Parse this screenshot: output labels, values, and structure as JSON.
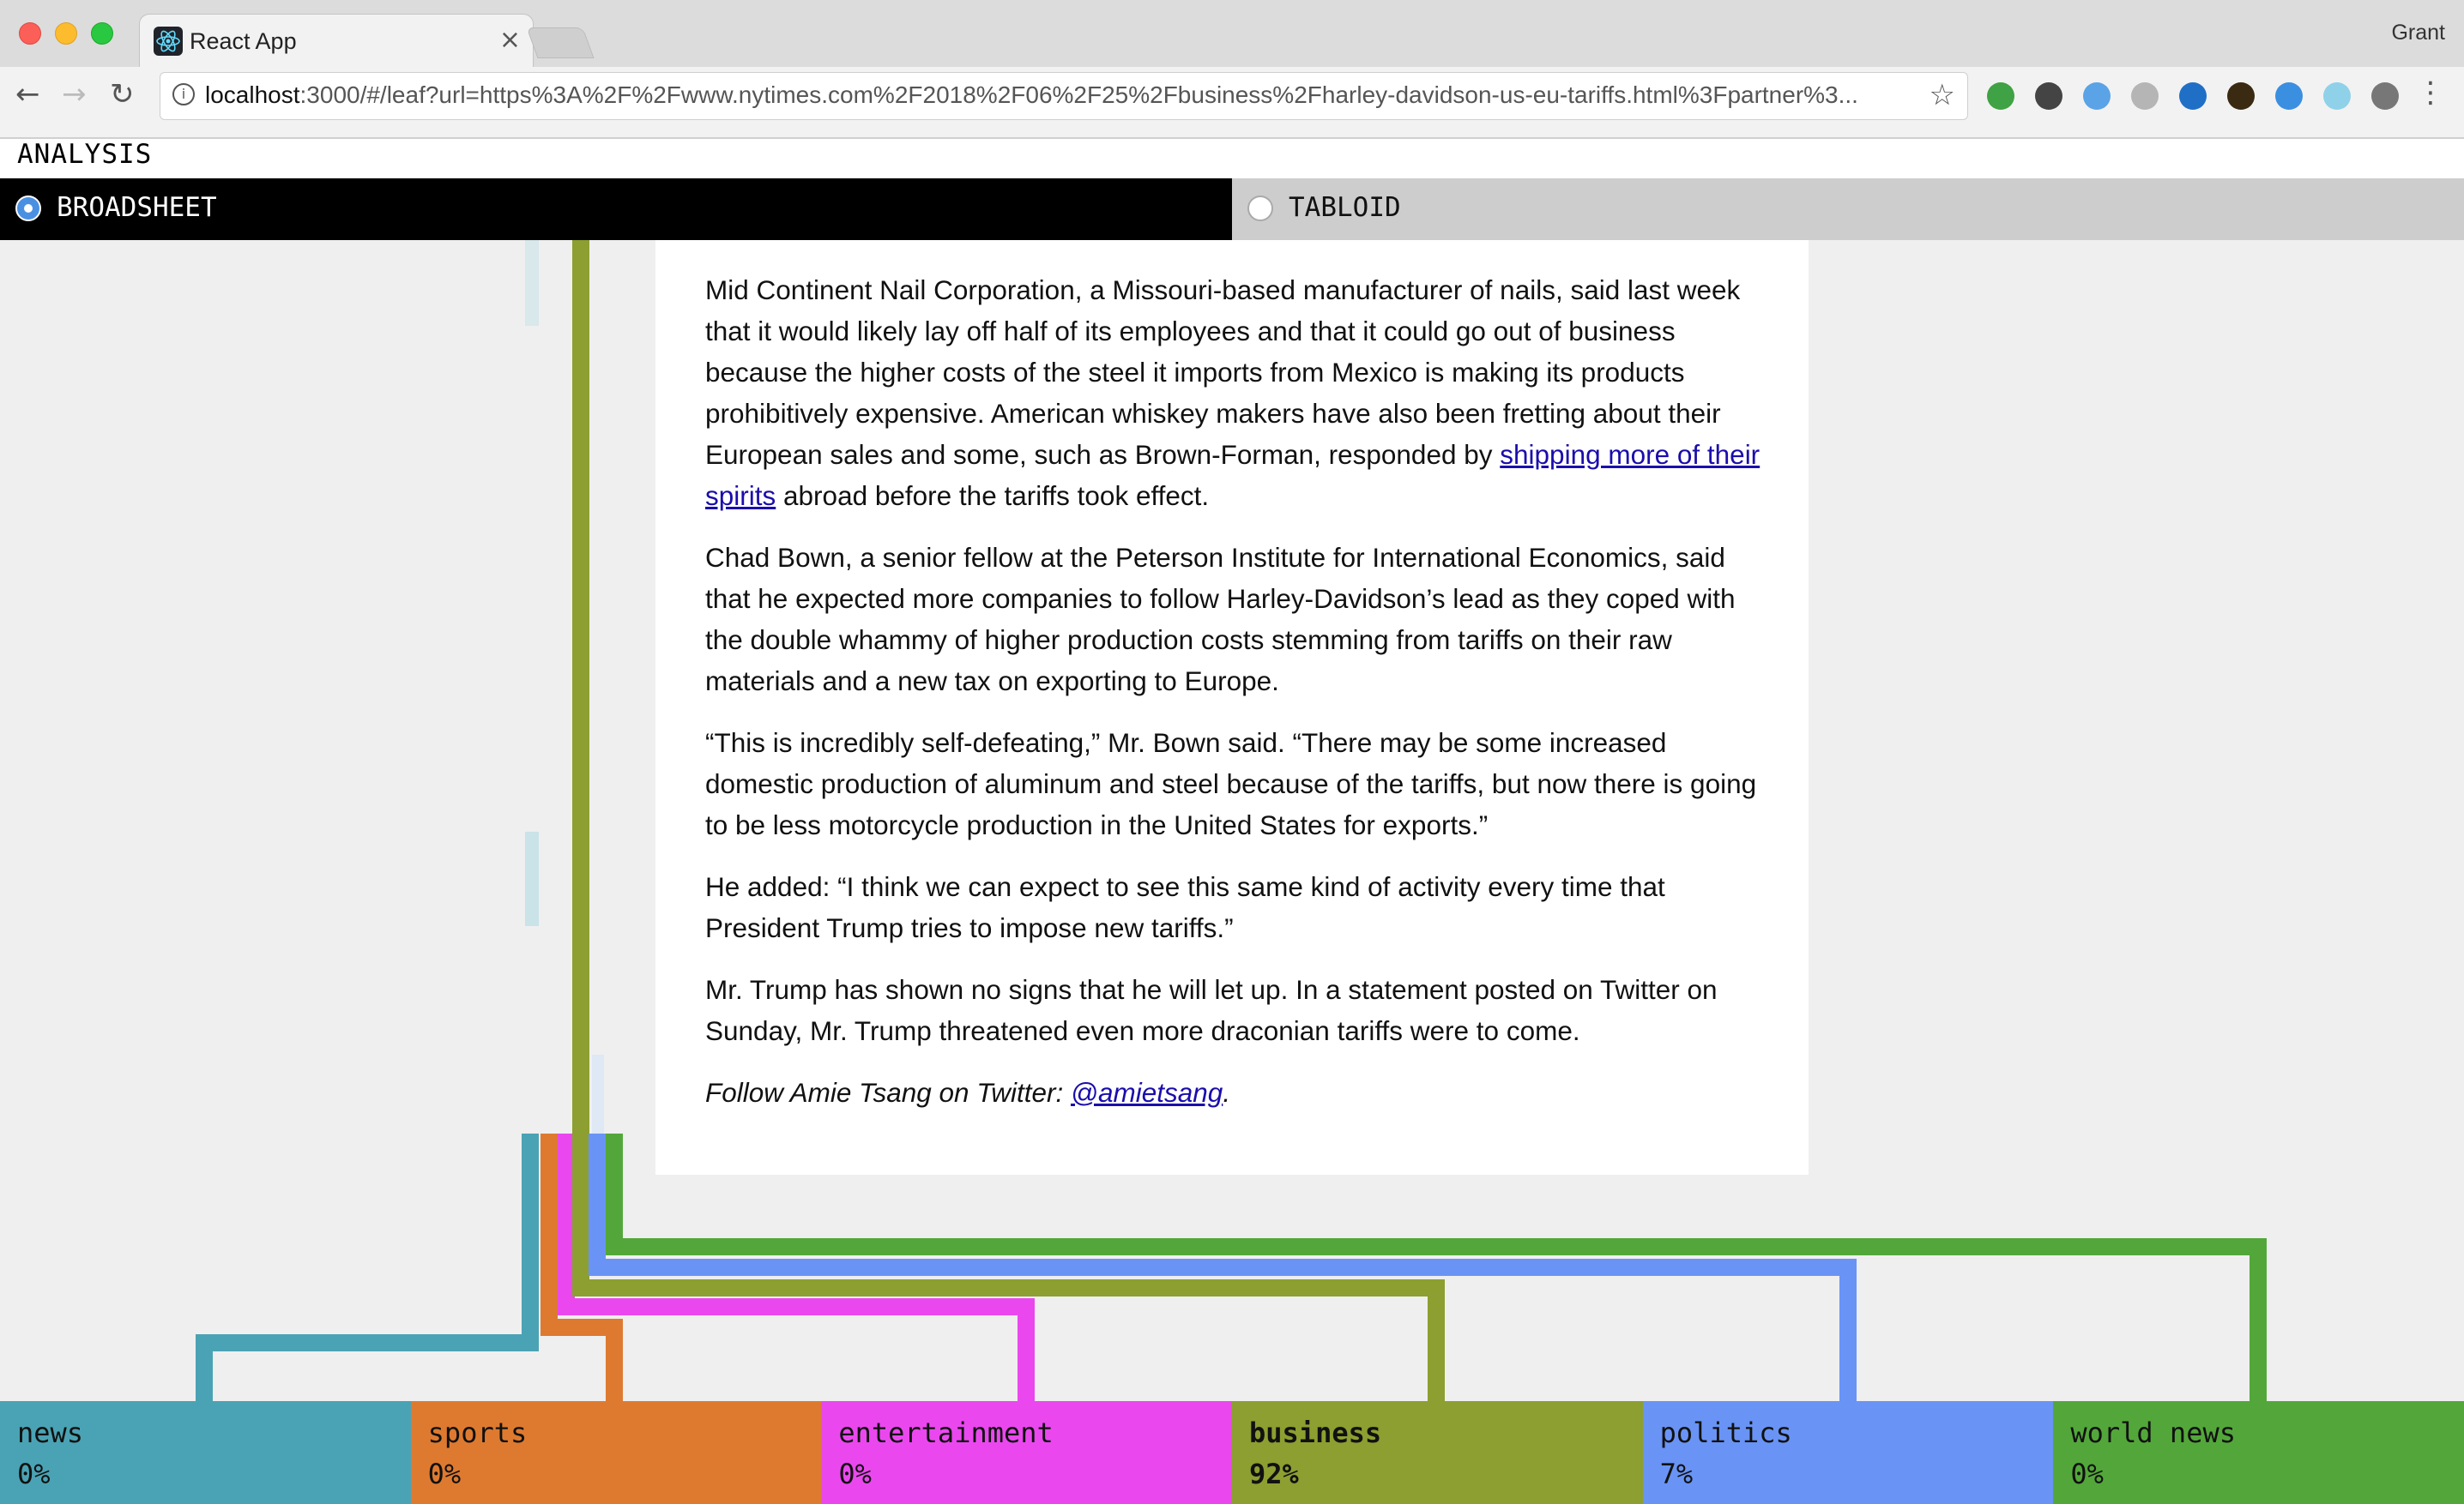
{
  "browser": {
    "tab_title": "React App",
    "tab_close": "×",
    "user_name": "Grant",
    "url_host": "localhost",
    "url_rest": ":3000/#/leaf?url=https%3A%2F%2Fwww.nytimes.com%2F2018%2F06%2F25%2Fbusiness%2Fharley-davidson-us-eu-tariffs.html%3Fpartner%3...",
    "back_icon": "←",
    "forward_icon": "→",
    "reload_icon": "↻",
    "star_icon": "☆",
    "menu_icon": "⋮",
    "extensions": [
      "#3fa244",
      "#444444",
      "#5aa3e6",
      "#b5b5b5",
      "#1f6fc7",
      "#3a2a12",
      "#3b8fe0",
      "#8fd1e8",
      "#777777"
    ]
  },
  "app": {
    "header_label": "ANALYSIS",
    "modes": {
      "broadsheet": "BROADSHEET",
      "tabloid": "TABLOID"
    }
  },
  "article": {
    "p1_pre": "Mid Continent Nail Corporation, a Missouri-based manufacturer of nails, said last week that it would likely lay off half of its employees and that it could go out of business because the higher costs of the steel it imports from Mexico is making its products prohibitively expensive. American whiskey makers have also been fretting about their European sales and some, such as Brown-Forman, responded by ",
    "p1_link": "shipping more of their spirits",
    "p1_post": " abroad before the tariffs took effect.",
    "p2": "Chad Bown, a senior fellow at the Peterson Institute for International Economics, said that he expected more companies to follow Harley-Davidson’s lead as they coped with the double whammy of higher production costs stemming from tariffs on their raw materials and a new tax on exporting to Europe.",
    "p3": "“This is incredibly self-defeating,” Mr. Bown said. “There may be some increased domestic production of aluminum and steel because of the tariffs, but now there is going to be less motorcycle production in the United States for exports.”",
    "p4": "He added: “I think we can expect to see this same kind of activity every time that President Trump tries to impose new tariffs.”",
    "p5": "Mr. Trump has shown no signs that he will let up. In a statement posted on Twitter on Sunday, Mr. Trump threatened even more draconian tariffs were to come.",
    "follow_pre": "Follow Amie Tsang on Twitter: ",
    "follow_link": "@amietsang",
    "follow_post": "."
  },
  "categories": [
    {
      "name": "news",
      "pct": "0%",
      "color": "#4aa3b4",
      "bold": false
    },
    {
      "name": "sports",
      "pct": "0%",
      "color": "#de7a30",
      "bold": false
    },
    {
      "name": "entertainment",
      "pct": "0%",
      "color": "#ea48ee",
      "bold": false
    },
    {
      "name": "business",
      "pct": "92%",
      "color": "#8c9f30",
      "bold": true
    },
    {
      "name": "politics",
      "pct": "7%",
      "color": "#6994f5",
      "bold": false
    },
    {
      "name": "world news",
      "pct": "0%",
      "color": "#53a73a",
      "bold": false
    }
  ]
}
